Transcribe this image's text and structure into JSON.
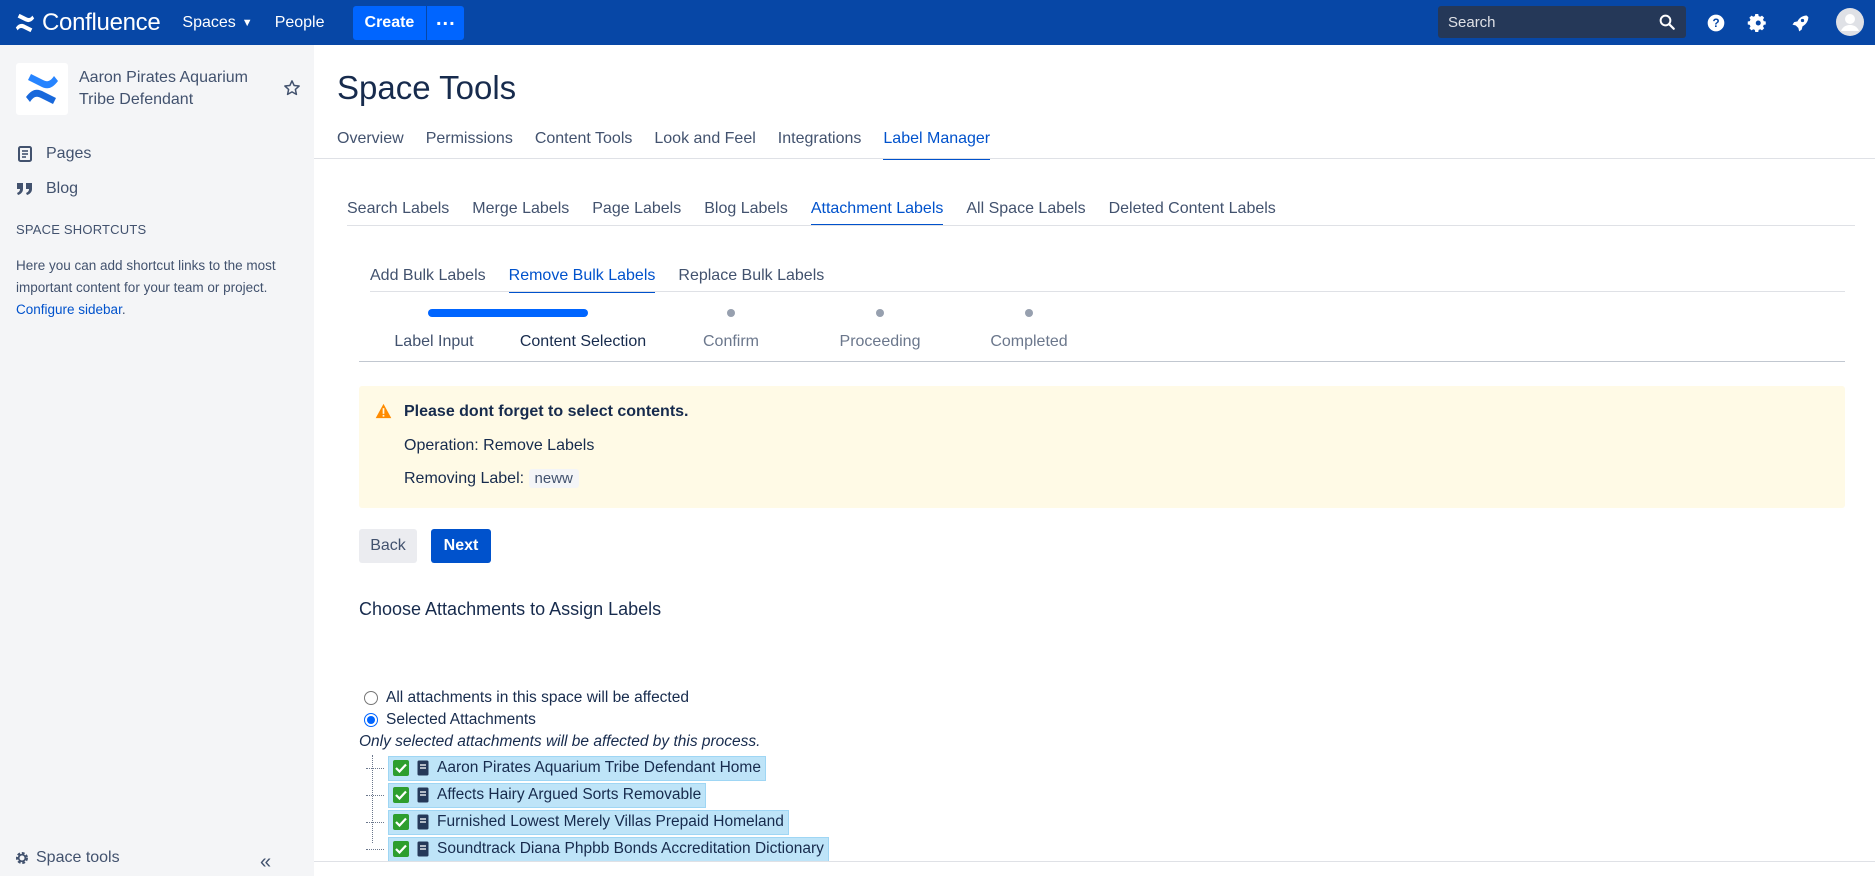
{
  "topbar": {
    "brand": "Confluence",
    "nav": {
      "spaces": "Spaces",
      "people": "People"
    },
    "create_label": "Create",
    "search_placeholder": "Search"
  },
  "sidebar": {
    "space_name": "Aaron Pirates Aquarium Tribe Defendant",
    "items": [
      {
        "label": "Pages",
        "icon": "pages-icon"
      },
      {
        "label": "Blog",
        "icon": "blog-quote-icon"
      }
    ],
    "shortcuts_title": "SPACE SHORTCUTS",
    "shortcuts_text": "Here you can add shortcut links to the most important content for your team or project.",
    "configure_link": "Configure sidebar",
    "space_tools": "Space tools"
  },
  "main": {
    "title": "Space Tools",
    "tabs": [
      "Overview",
      "Permissions",
      "Content Tools",
      "Look and Feel",
      "Integrations",
      "Label Manager"
    ],
    "active_tab": "Label Manager",
    "subtabs": [
      "Search Labels",
      "Merge Labels",
      "Page Labels",
      "Blog Labels",
      "Attachment Labels",
      "All Space Labels",
      "Deleted Content Labels"
    ],
    "active_subtab": "Attachment Labels",
    "bulk_tabs": [
      "Add Bulk Labels",
      "Remove Bulk Labels",
      "Replace Bulk Labels"
    ],
    "active_bulk_tab": "Remove Bulk Labels",
    "steps": [
      "Label Input",
      "Content Selection",
      "Confirm",
      "Proceeding",
      "Completed"
    ],
    "current_step": "Content Selection",
    "warning": {
      "title": "Please dont forget to select contents.",
      "operation": "Operation: Remove Labels",
      "removing_label_prefix": "Removing Label:",
      "label": "neww"
    },
    "back_label": "Back",
    "next_label": "Next",
    "section_title": "Choose Attachments to Assign Labels",
    "radio_all": "All attachments in this space will be affected",
    "radio_selected": "Selected Attachments",
    "selected_option": "Selected Attachments",
    "note": "Only selected attachments will be affected by this process.",
    "tree_items": [
      "Aaron Pirates Aquarium Tribe Defendant Home",
      "Affects Hairy Argued Sorts Removable",
      "Furnished Lowest Merely Villas Prepaid Homeland",
      "Soundtrack Diana Phpbb Bonds Accreditation Dictionary"
    ]
  },
  "colors": {
    "topbar": "#0747a6",
    "accent": "#0052cc",
    "warning_bg": "#fffae6",
    "tree_selected": "#bee4f8"
  }
}
